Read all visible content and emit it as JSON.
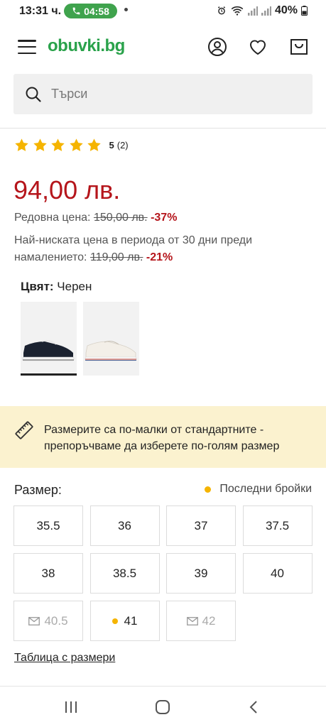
{
  "status_bar": {
    "time": "13:31 ч.",
    "call_timer": "04:58",
    "battery": "40%"
  },
  "header": {
    "logo_main": "obuvki",
    "logo_tld": ".bg"
  },
  "search": {
    "placeholder": "Търси"
  },
  "rating": {
    "stars": 5,
    "value": "5",
    "count": "(2)"
  },
  "price": {
    "current": "94,00 лв.",
    "regular_label": "Редовна цена:",
    "regular_value": "150,00 лв.",
    "regular_discount": "-37%",
    "lowest_text": "Най-ниската цена в периода от 30 дни преди намалението:",
    "lowest_value": "119,00 лв.",
    "lowest_discount": "-21%"
  },
  "color": {
    "label": "Цвят:",
    "value": "Черен"
  },
  "notice": {
    "text": "Размерите са по-малки от стандартните - препоръчваме да изберете по-голям размер"
  },
  "sizes": {
    "label": "Размер:",
    "last_items_label": "Последни бройки",
    "items": [
      {
        "size": "35.5",
        "state": "available"
      },
      {
        "size": "36",
        "state": "available"
      },
      {
        "size": "37",
        "state": "available"
      },
      {
        "size": "37.5",
        "state": "available"
      },
      {
        "size": "38",
        "state": "available"
      },
      {
        "size": "38.5",
        "state": "available"
      },
      {
        "size": "39",
        "state": "available"
      },
      {
        "size": "40",
        "state": "available"
      },
      {
        "size": "40.5",
        "state": "notify"
      },
      {
        "size": "41",
        "state": "last"
      },
      {
        "size": "42",
        "state": "notify"
      }
    ],
    "size_table_link": "Таблица с размери"
  },
  "colors": {
    "price_red": "#b5151b",
    "brand_green": "#2aa24b",
    "notice_bg": "#fbf2cf",
    "star_yellow": "#f5b400"
  }
}
